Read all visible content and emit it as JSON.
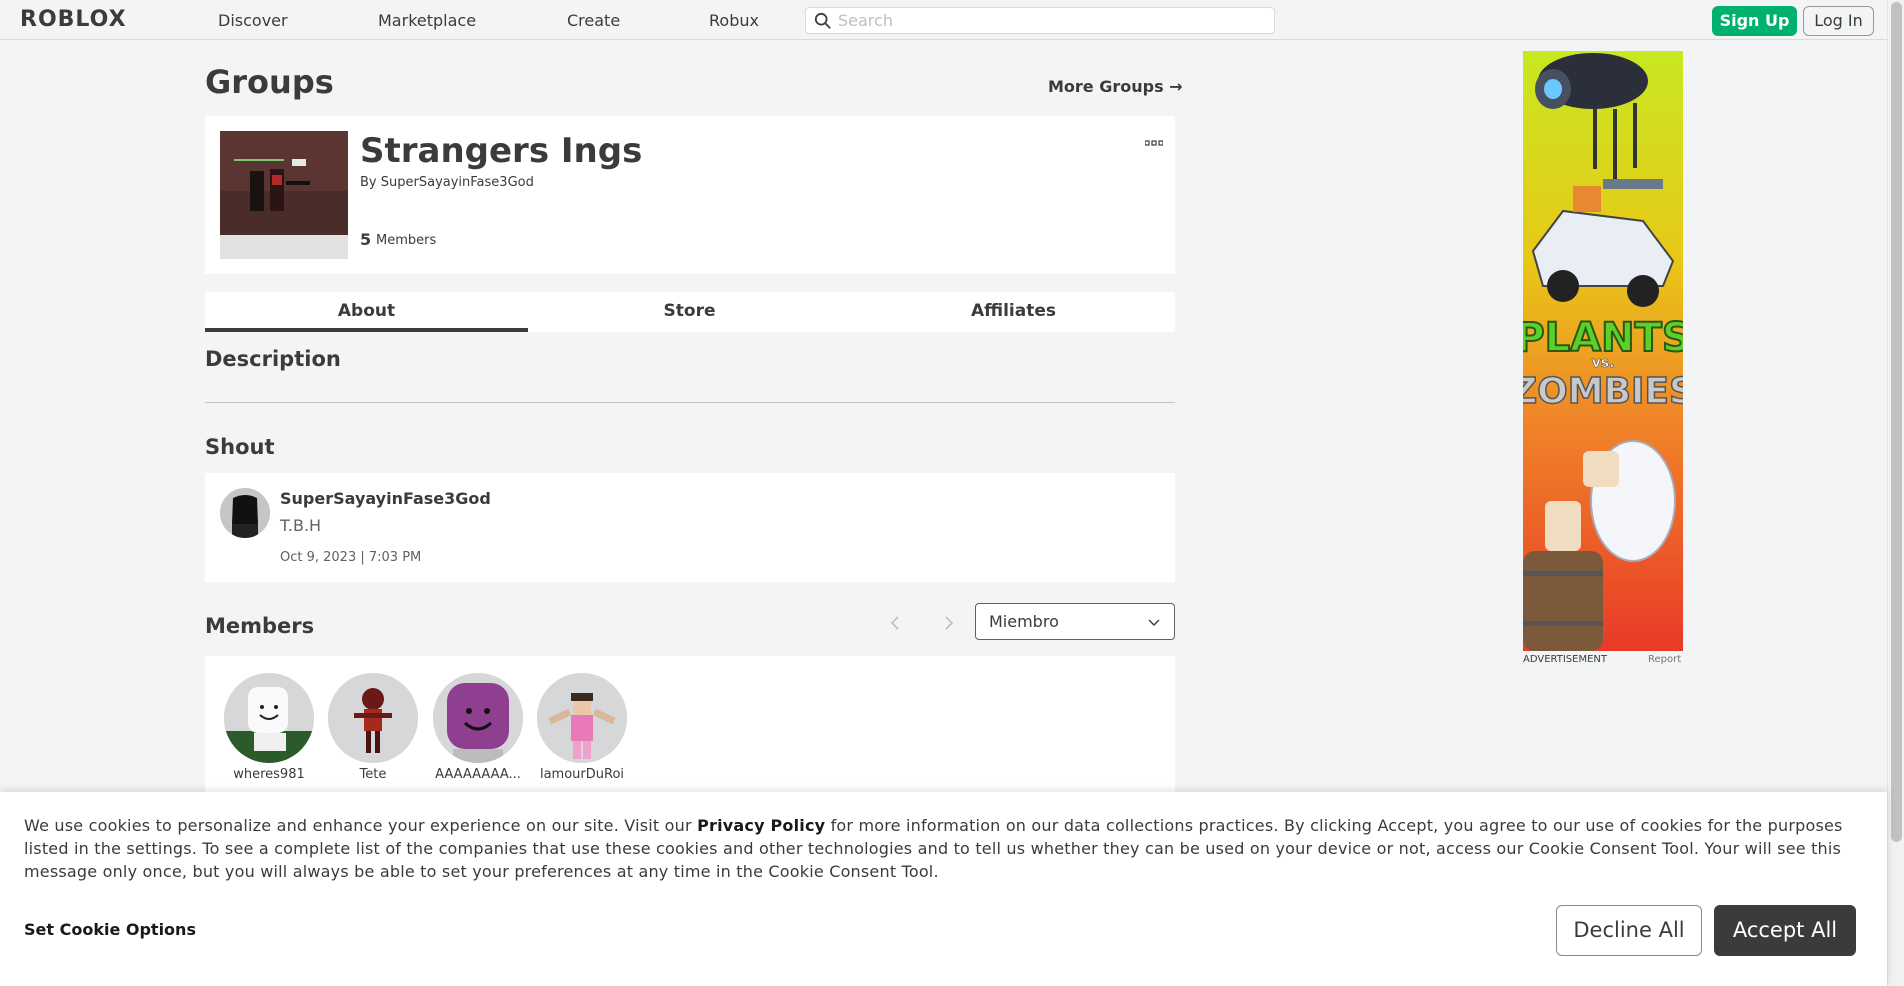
{
  "nav": {
    "logo": "ROBLOX",
    "links": [
      "Discover",
      "Marketplace",
      "Create",
      "Robux"
    ],
    "search_placeholder": "Search",
    "signup": "Sign Up",
    "login": "Log In"
  },
  "page": {
    "title": "Groups",
    "more_groups": "More Groups →"
  },
  "group": {
    "name": "Strangers Ings",
    "by_label": "By",
    "owner": "SuperSayayinFase3God",
    "member_count": "5",
    "member_count_label": "Members",
    "more_icon": "ellipsis-icon"
  },
  "tabs": [
    "About",
    "Store",
    "Affiliates"
  ],
  "description": {
    "heading": "Description"
  },
  "shout": {
    "heading": "Shout",
    "user": "SuperSayayinFase3God",
    "body": "T.B.H",
    "date": "Oct 9, 2023 | 7:03 PM"
  },
  "members": {
    "heading": "Members",
    "role_selected": "Miembro",
    "list": [
      {
        "name": "wheres981"
      },
      {
        "name": "Tete"
      },
      {
        "name": "AAAAAAAA..."
      },
      {
        "name": "lamourDuRoi"
      }
    ]
  },
  "ad": {
    "label": "ADVERTISEMENT",
    "report": "Report",
    "headline_1": "PLANTS",
    "headline_2": "vs.",
    "headline_3": "ZOMBIES"
  },
  "cookie": {
    "text_before": "We use cookies to personalize and enhance your experience on our site. Visit our ",
    "link": "Privacy Policy",
    "text_after": " for more information on our data collections practices. By clicking Accept, you agree to our use of cookies for the purposes listed in the settings. To see a complete list of the companies that use these cookies and other technologies and to tell us whether they can be used on your device or not, access our Cookie Consent Tool. Your will see this message only once, but you will always be able to set your preferences at any time in the Cookie Consent Tool.",
    "options": "Set Cookie Options",
    "decline": "Decline All",
    "accept": "Accept All"
  }
}
